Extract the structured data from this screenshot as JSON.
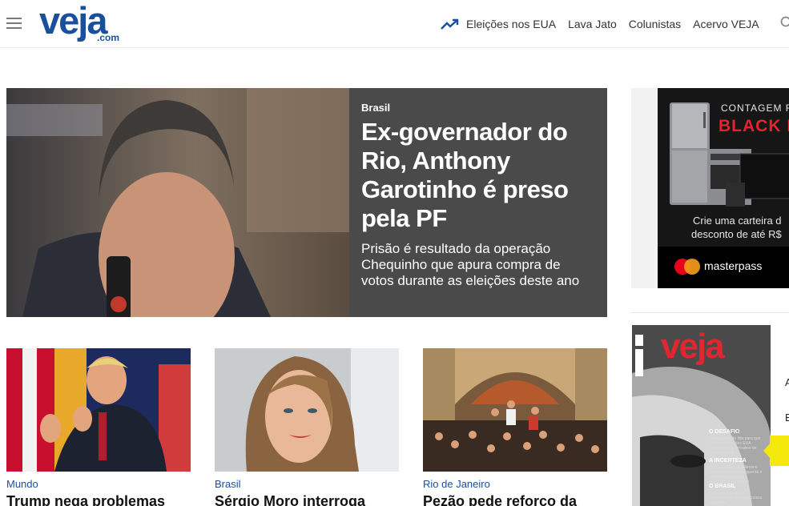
{
  "header": {
    "logo_main": "veja",
    "logo_sub": ".com",
    "nav": [
      {
        "label": "Eleições nos EUA",
        "icon": "trending-up-icon"
      },
      {
        "label": "Lava Jato"
      },
      {
        "label": "Colunistas"
      },
      {
        "label": "Acervo VEJA"
      }
    ]
  },
  "hero": {
    "category": "Brasil",
    "title": "Ex-governador do Rio, Anthony Garotinho é preso pela PF",
    "subtitle": "Prisão é resultado da operação Chequinho que apura compra de votos durante as eleições deste ano"
  },
  "cards": [
    {
      "category": "Mundo",
      "title": "Trump nega problemas"
    },
    {
      "category": "Brasil",
      "title": "Sérgio Moro interroga"
    },
    {
      "category": "Rio de Janeiro",
      "title": "Pezão pede reforço da"
    }
  ],
  "ad": {
    "count": "CONTAGEM R",
    "black": "BLACK F",
    "line1": "Crie uma carteira d",
    "line2": "desconto de até R$",
    "brand": "masterpass"
  },
  "magazine": {
    "logo": "veja",
    "h1": "O DESAFIO",
    "t1": "Como o mundo lida para que as instituições dos EUA contenham os arroubos de Donald Trump",
    "h2": "A INCERTEZA",
    "t2": "Como a vitória do bilionário americano afeta a esquerda e a direita populista e nacionalista no mundo",
    "h3": "O BRASIL",
    "t3": "Como as ameaças protecionistas afetam a nossa economia"
  },
  "side_letters": [
    "A",
    "E"
  ],
  "colors": {
    "brand_blue": "#1a4f9c",
    "hero_panel": "#4a4a4a",
    "ad_red": "#e5232e",
    "accent_yellow": "#f4e70a"
  }
}
